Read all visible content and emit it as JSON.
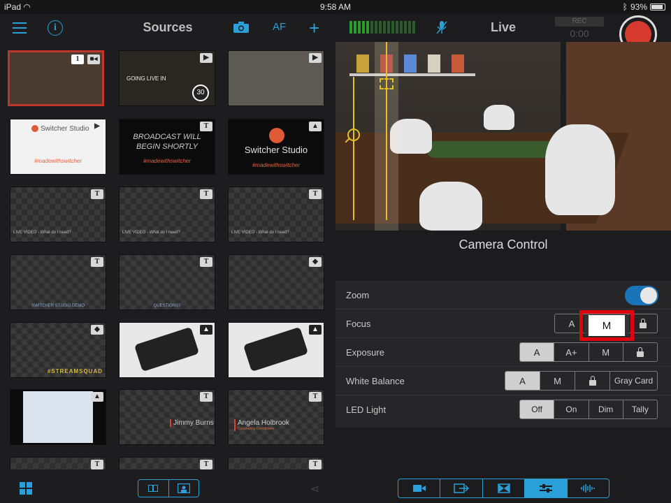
{
  "status": {
    "device": "iPad",
    "time": "9:58 AM",
    "battery": "93%"
  },
  "sources": {
    "title": "Sources",
    "af_label": "AF",
    "tiles": [
      {
        "badge_num": "1"
      },
      {
        "coming_text": "GOING LIVE IN",
        "countdown": "30"
      },
      {},
      {
        "logo": "Switcher Studio",
        "hashtag": "#madewithswitcher"
      },
      {
        "line1": "BROADCAST WILL",
        "line2": "BEGIN SHORTLY",
        "hashtag": "#madewithswitcher"
      },
      {
        "logo": "Switcher Studio",
        "hashtag": "#madewithswitcher"
      },
      {
        "caption": "LIVE VIDEO - What do I need?"
      },
      {
        "caption": "LIVE VIDEO - What do I need?"
      },
      {
        "caption": "LIVE VIDEO - What do I need?"
      },
      {
        "bottom": "SWITCHER STUDIO DEMO"
      },
      {
        "bottom": "QUESTIONS?"
      },
      {},
      {
        "streamsquad": "#STREAMSQUAD"
      },
      {},
      {},
      {},
      {
        "name": "Jimmy Burns"
      },
      {
        "name": "Angela Holbrook",
        "role": "Community Coordinator"
      }
    ]
  },
  "live": {
    "title": "Live",
    "rec_label": "REC",
    "rec_time": "0:00",
    "camera_control_title": "Camera Control",
    "rows": {
      "zoom": {
        "label": "Zoom",
        "on": true
      },
      "focus": {
        "label": "Focus",
        "options": [
          "A",
          "M"
        ],
        "selected": "M"
      },
      "exposure": {
        "label": "Exposure",
        "options": [
          "A",
          "A+",
          "M"
        ],
        "selected": "A"
      },
      "white_balance": {
        "label": "White Balance",
        "options": [
          "A",
          "M",
          "Gray Card"
        ],
        "selected": "A"
      },
      "led": {
        "label": "LED Light",
        "options": [
          "Off",
          "On",
          "Dim",
          "Tally"
        ],
        "selected": "Off"
      }
    }
  },
  "colors": {
    "accent": "#2a9fd8",
    "record": "#d63a2f",
    "highlight": "#e0000e",
    "selected_border": "#c1352a"
  }
}
